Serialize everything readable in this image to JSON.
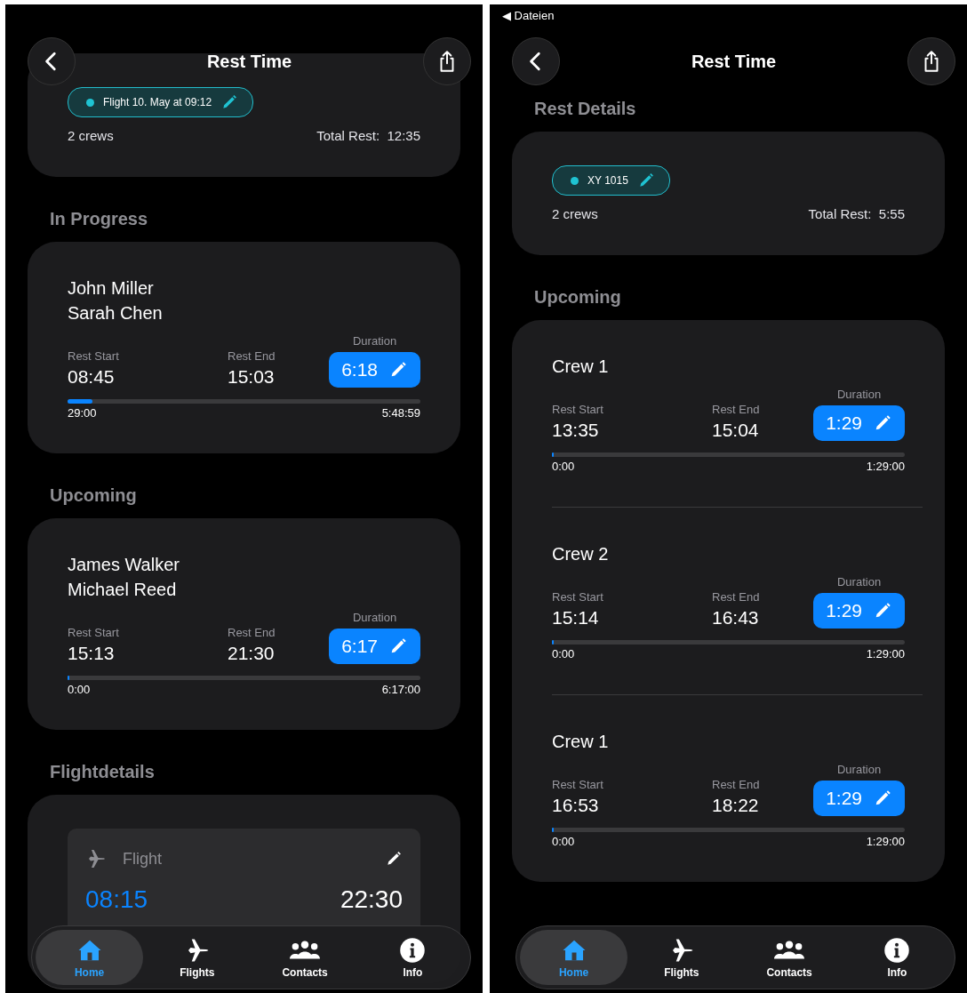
{
  "screens": [
    {
      "title": "Rest Time",
      "sections": [
        {
          "kind": "details",
          "tag": "Flight 10. May at 09:12",
          "crews": "2 crews",
          "total_label": "Total Rest:",
          "total": "12:35"
        },
        {
          "kind": "crews",
          "title": "In Progress",
          "items": [
            {
              "names": [
                "John Miller",
                "Sarah Chen"
              ],
              "start_label": "Rest Start",
              "start": "08:45",
              "end_label": "Rest End",
              "end": "15:03",
              "duration_label": "Duration",
              "duration": "6:18",
              "level": 0.07,
              "elapsed": "29:00",
              "remaining": "5:48:59"
            }
          ]
        },
        {
          "kind": "crews",
          "title": "Upcoming",
          "items": [
            {
              "names": [
                "James Walker",
                "Michael Reed"
              ],
              "start_label": "Rest Start",
              "start": "15:13",
              "end_label": "Rest End",
              "end": "21:30",
              "duration_label": "Duration",
              "duration": "6:17",
              "level": 0,
              "elapsed": "0:00",
              "remaining": "6:17:00"
            }
          ]
        },
        {
          "kind": "flight",
          "title": "Flightdetails",
          "label": "Flight",
          "departure": "08:15",
          "arrival": "22:30"
        }
      ],
      "tabs": [
        {
          "label": "Home",
          "selected": true
        },
        {
          "label": "Flights",
          "selected": false
        },
        {
          "label": "Contacts",
          "selected": false
        },
        {
          "label": "Info",
          "selected": false
        }
      ]
    },
    {
      "status_link": "◀ Dateien",
      "title": "Rest Time",
      "sections": [
        {
          "kind": "details",
          "title": "Rest Details",
          "tag": "XY 1015",
          "crews": "2 crews",
          "total_label": "Total Rest:",
          "total": "5:55"
        },
        {
          "kind": "crews",
          "title": "Upcoming",
          "items": [
            {
              "names": [
                "Crew 1"
              ],
              "start_label": "Rest Start",
              "start": "13:35",
              "end_label": "Rest End",
              "end": "15:04",
              "duration_label": "Duration",
              "duration": "1:29",
              "level": 0,
              "elapsed": "0:00",
              "remaining": "1:29:00"
            },
            {
              "names": [
                "Crew 2"
              ],
              "start_label": "Rest Start",
              "start": "15:14",
              "end_label": "Rest End",
              "end": "16:43",
              "duration_label": "Duration",
              "duration": "1:29",
              "level": 0,
              "elapsed": "0:00",
              "remaining": "1:29:00"
            },
            {
              "names": [
                "Crew 1"
              ],
              "start_label": "Rest Start",
              "start": "16:53",
              "end_label": "Rest End",
              "end": "18:22",
              "duration_label": "Duration",
              "duration": "1:29",
              "level": 0,
              "elapsed": "0:00",
              "remaining": "1:29:00"
            }
          ]
        }
      ],
      "tabs": [
        {
          "label": "Home",
          "selected": true
        },
        {
          "label": "Flights",
          "selected": false
        },
        {
          "label": "Contacts",
          "selected": false
        },
        {
          "label": "Info",
          "selected": false
        }
      ]
    }
  ]
}
